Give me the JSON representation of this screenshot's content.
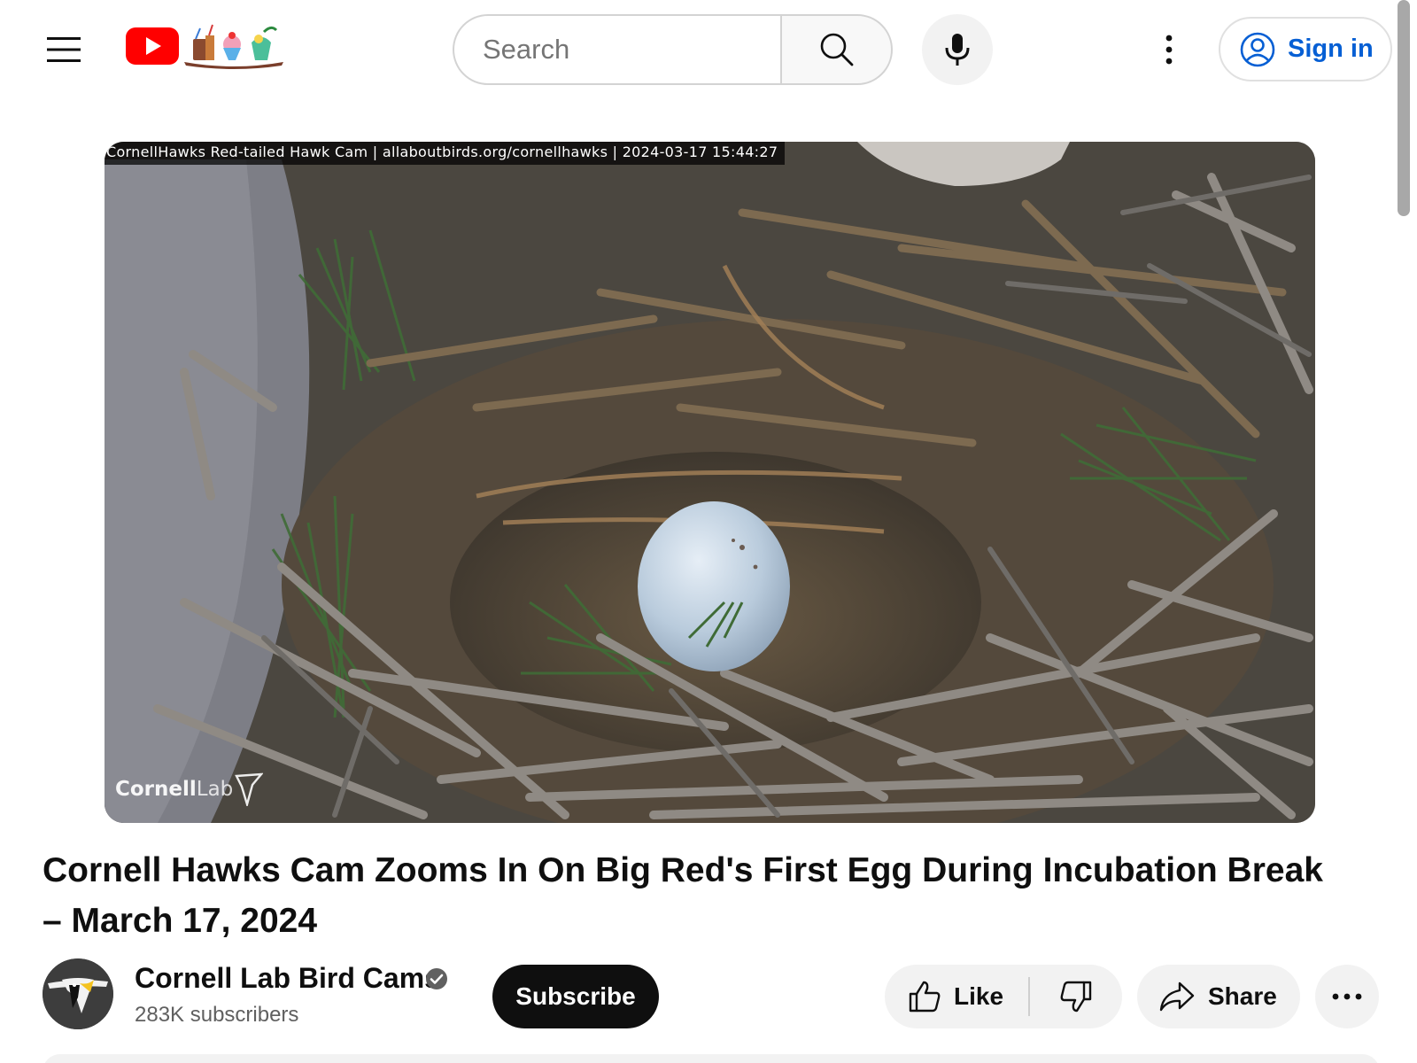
{
  "header": {
    "search_placeholder": "Search",
    "signin_label": "Sign in",
    "logo_icon": "youtube-logo-icon",
    "doodle_icon": "seasonal-doodle-icon"
  },
  "video": {
    "overlay_text": "CornellHawks Red-tailed Hawk Cam | allaboutbirds.org/cornellhawks | 2024-03-17 15:44:27",
    "watermark_bold": "Cornell",
    "watermark_light": "Lab"
  },
  "title": "Cornell Hawks Cam Zooms In On Big Red's First Egg During Incubation Break – March 17, 2024",
  "channel": {
    "name": "Cornell Lab Bird Cams",
    "subscribers": "283K subscribers",
    "verified": true
  },
  "actions": {
    "subscribe_label": "Subscribe",
    "like_label": "Like",
    "share_label": "Share"
  },
  "colors": {
    "brand_red": "#ff0000",
    "link_blue": "#065fd4",
    "button_gray": "#f2f2f2",
    "subscribe_black": "#0f0f0f"
  }
}
